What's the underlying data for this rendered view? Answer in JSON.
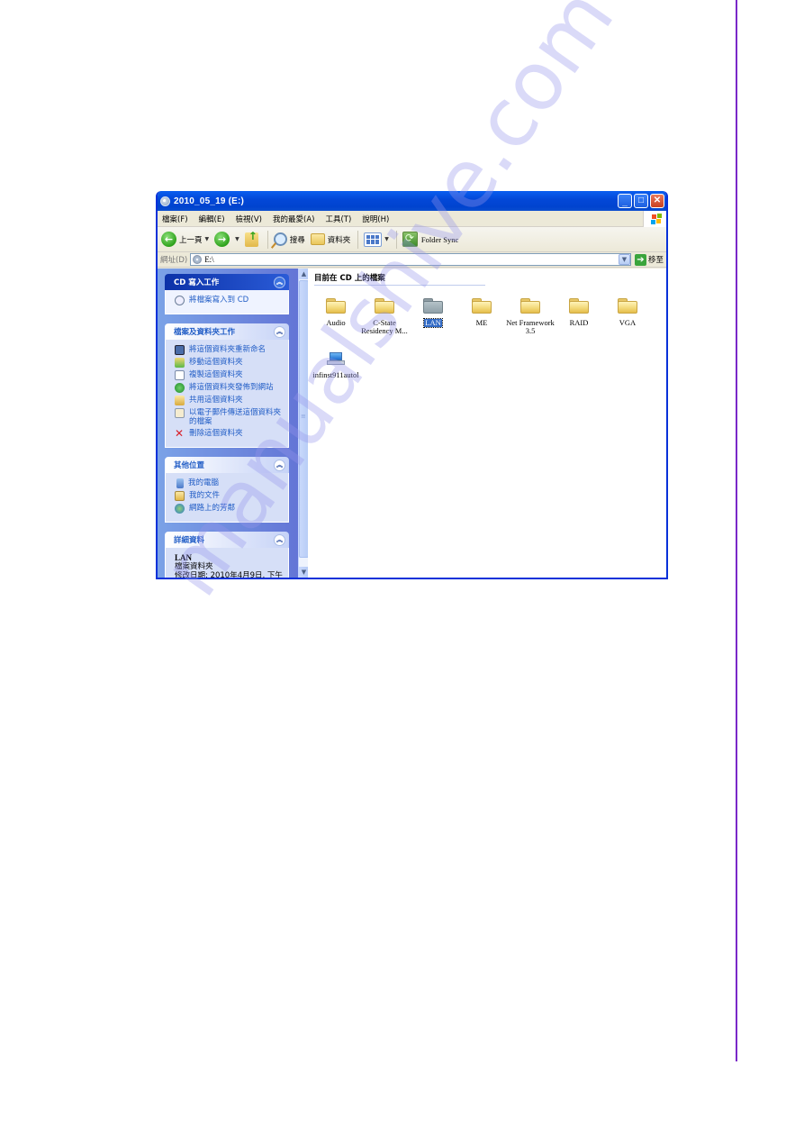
{
  "window": {
    "title": "2010_05_19 (E:)",
    "controls": {
      "minimize": "_",
      "maximize": "□",
      "close": "✕"
    }
  },
  "menubar": {
    "items": [
      "檔案(F)",
      "編輯(E)",
      "檢視(V)",
      "我的最愛(A)",
      "工具(T)",
      "說明(H)"
    ]
  },
  "toolbar": {
    "back_label": "上一頁",
    "search_label": "搜尋",
    "folders_label": "資料夾",
    "folder_sync_label": "Folder Sync"
  },
  "addressbar": {
    "label": "網址(D)",
    "value": "E:\\",
    "go_label": "移至"
  },
  "taskpane": {
    "cd_tasks": {
      "title": "CD 寫入工作",
      "items": [
        "將檔案寫入到 CD"
      ]
    },
    "file_tasks": {
      "title": "檔案及資料夾工作",
      "items": [
        "將這個資料夾重新命名",
        "移動這個資料夾",
        "複製這個資料夾",
        "將這個資料夾發佈到網站",
        "共用這個資料夾",
        "以電子郵件傳送這個資料夾的檔案",
        "刪除這個資料夾"
      ]
    },
    "other_places": {
      "title": "其他位置",
      "items": [
        "我的電腦",
        "我的文件",
        "網路上的芳鄰"
      ]
    },
    "details": {
      "title": "詳細資料",
      "name": "LAN",
      "type": "檔案資料夾",
      "modified": "修改日期: 2010年4月9日, 下午"
    }
  },
  "content": {
    "heading": "目前在 CD 上的檔案",
    "items": [
      {
        "name": "Audio",
        "type": "folder",
        "selected": false
      },
      {
        "name": "C-State Residency M...",
        "type": "folder",
        "selected": false
      },
      {
        "name": "LAN",
        "type": "folder",
        "selected": true
      },
      {
        "name": "ME",
        "type": "folder",
        "selected": false
      },
      {
        "name": "Net Framework 3.5",
        "type": "folder",
        "selected": false
      },
      {
        "name": "RAID",
        "type": "folder",
        "selected": false
      },
      {
        "name": "VGA",
        "type": "folder",
        "selected": false
      },
      {
        "name": "infinst911autol",
        "type": "application",
        "selected": false
      }
    ]
  },
  "watermark": "manualshive.com",
  "colors": {
    "titlebar": "#0348d8",
    "taskpane": "#7ba2e7",
    "link": "#215dc6",
    "selection": "#316ac5",
    "page_rule": "#7a28c8"
  }
}
